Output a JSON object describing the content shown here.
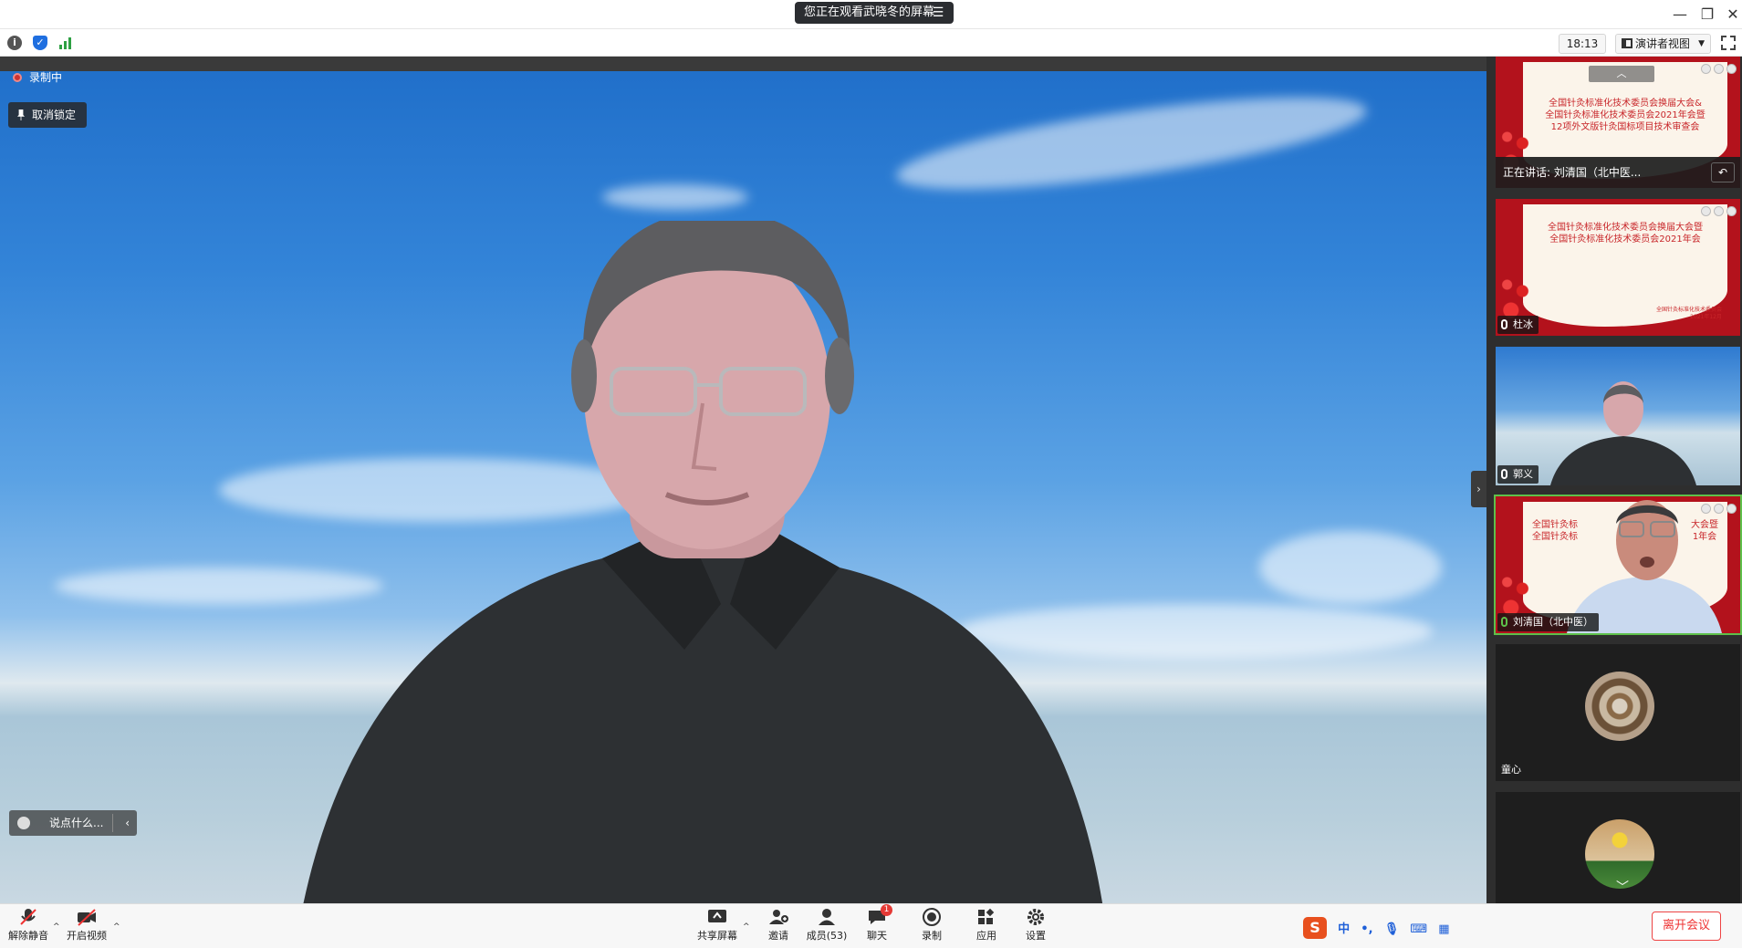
{
  "window": {
    "watching_text": "您正在观看武晓冬的屏幕",
    "menu_glyph": "☰",
    "controls": {
      "minimize": "—",
      "restore": "❐",
      "close": "✕"
    }
  },
  "infobar": {
    "clock": "18:13",
    "view_label": "演讲者视图",
    "icons": [
      "info-icon",
      "shield-icon",
      "signal-icon"
    ]
  },
  "main": {
    "recording_label": "录制中",
    "unpin_label": "取消锁定",
    "chat_placeholder": "说点什么...",
    "chat_arrow": "‹"
  },
  "side": {
    "toggle_arrow": "›",
    "scroll_up": "︿",
    "scroll_down": "﹀",
    "tiles": [
      {
        "type": "slide",
        "lines": [
          "全国针灸标准化技术委员会换届大会&",
          "全国针灸标准化技术委员会2021年会暨",
          "12项外文版针灸国标项目技术审查会"
        ],
        "speaking": "正在讲话: 刘清国（北中医...",
        "pin": "↶"
      },
      {
        "type": "slide",
        "lines": [
          "全国针灸标准化技术委员会换届大会暨",
          "全国针灸标准化技术委员会2021年会"
        ],
        "name": "杜冰",
        "footer_line1": "全国针灸标准化技术委员会",
        "footer_line2": "2021年12月"
      },
      {
        "type": "video",
        "name": "郭义"
      },
      {
        "type": "video-slide",
        "name": "刘清国（北中医）",
        "lines": [
          "全国针灸标",
          "大会暨",
          "全国针灸标",
          "1年会"
        ]
      },
      {
        "type": "avatar",
        "name": "童心"
      },
      {
        "type": "avatar",
        "name": ""
      }
    ]
  },
  "toolbar": {
    "mute_label": "解除静音",
    "video_label": "开启视频",
    "share_label": "共享屏幕",
    "invite_label": "邀请",
    "members_label": "成员(53)",
    "chat_label": "聊天",
    "chat_badge": "1",
    "record_label": "录制",
    "apps_label": "应用",
    "settings_label": "设置",
    "leave_label": "离开会议",
    "ime": {
      "logo": "S",
      "lang": "中",
      "punct": "•,",
      "mic": "🎙",
      "kbd": "⌨",
      "grid": "▦"
    },
    "caret": "^"
  },
  "colors": {
    "accent_green": "#5ec04a",
    "leave_red": "#e33333",
    "panel_bg": "#2e2e2e"
  }
}
